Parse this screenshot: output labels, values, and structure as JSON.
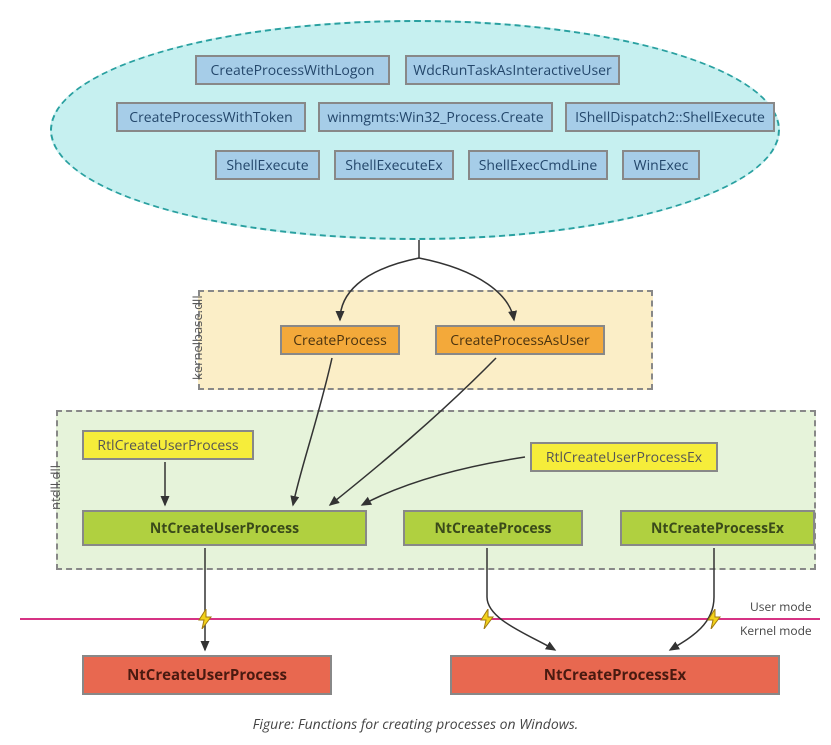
{
  "top_ellipse": {
    "boxes": [
      "CreateProcessWithLogon",
      "WdcRunTaskAsInteractiveUser",
      "CreateProcessWithToken",
      "winmgmts:Win32_Process.Create",
      "IShellDispatch2::ShellExecute",
      "ShellExecute",
      "ShellExecuteEx",
      "ShellExecCmdLine",
      "WinExec"
    ]
  },
  "kernelbase": {
    "label": "kernelbase.dll",
    "boxes": [
      "CreateProcess",
      "CreateProcessAsUser"
    ]
  },
  "ntdll": {
    "label": "ntdll.dll",
    "yellow_boxes": [
      "RtlCreateUserProcess",
      "RtlCreateUserProcessEx"
    ],
    "green_boxes": [
      "NtCreateUserProcess",
      "NtCreateProcess",
      "NtCreateProcessEx"
    ]
  },
  "mode_divider": {
    "user": "User mode",
    "kernel": "Kernel mode"
  },
  "kernel_boxes": [
    "NtCreateUserProcess",
    "NtCreateProcessEx"
  ],
  "caption": "Figure: Functions for creating processes on Windows."
}
